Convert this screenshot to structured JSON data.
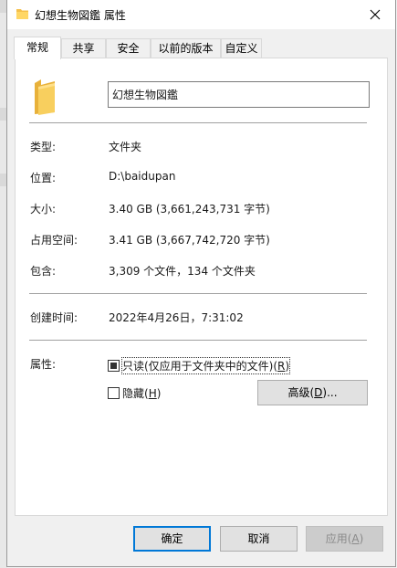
{
  "window": {
    "title": "幻想生物図鑑 属性",
    "close_icon": "close-icon"
  },
  "tabs": [
    {
      "label": "常规",
      "active": true
    },
    {
      "label": "共享",
      "active": false
    },
    {
      "label": "安全",
      "active": false
    },
    {
      "label": "以前的版本",
      "active": false
    },
    {
      "label": "自定义",
      "active": false
    }
  ],
  "general": {
    "name": "幻想生物図鑑",
    "rows": [
      {
        "label": "类型:",
        "value": "文件夹"
      },
      {
        "label": "位置:",
        "value": "D:\\baidupan"
      },
      {
        "label": "大小:",
        "value": "3.40 GB (3,661,243,731 字节)"
      },
      {
        "label": "占用空间:",
        "value": "3.41 GB (3,667,742,720 字节)"
      },
      {
        "label": "包含:",
        "value": "3,309 个文件，134 个文件夹"
      }
    ],
    "created_label": "创建时间:",
    "created_value": "2022年4月26日，7:31:02",
    "attributes_label": "属性:",
    "readonly": {
      "text": "只读(仅应用于文件夹中的文件)(",
      "key": "R",
      "suffix": ")",
      "state": "indeterminate"
    },
    "hidden": {
      "text": "隐藏(",
      "key": "H",
      "suffix": ")",
      "checked": false
    },
    "advanced": {
      "text": "高级(",
      "key": "D",
      "suffix": ")..."
    }
  },
  "footer": {
    "ok": "确定",
    "cancel": "取消",
    "apply_text": "应用(",
    "apply_key": "A",
    "apply_suffix": ")"
  },
  "colors": {
    "folder": "#f5c04a",
    "focus_border": "#0078d7"
  }
}
